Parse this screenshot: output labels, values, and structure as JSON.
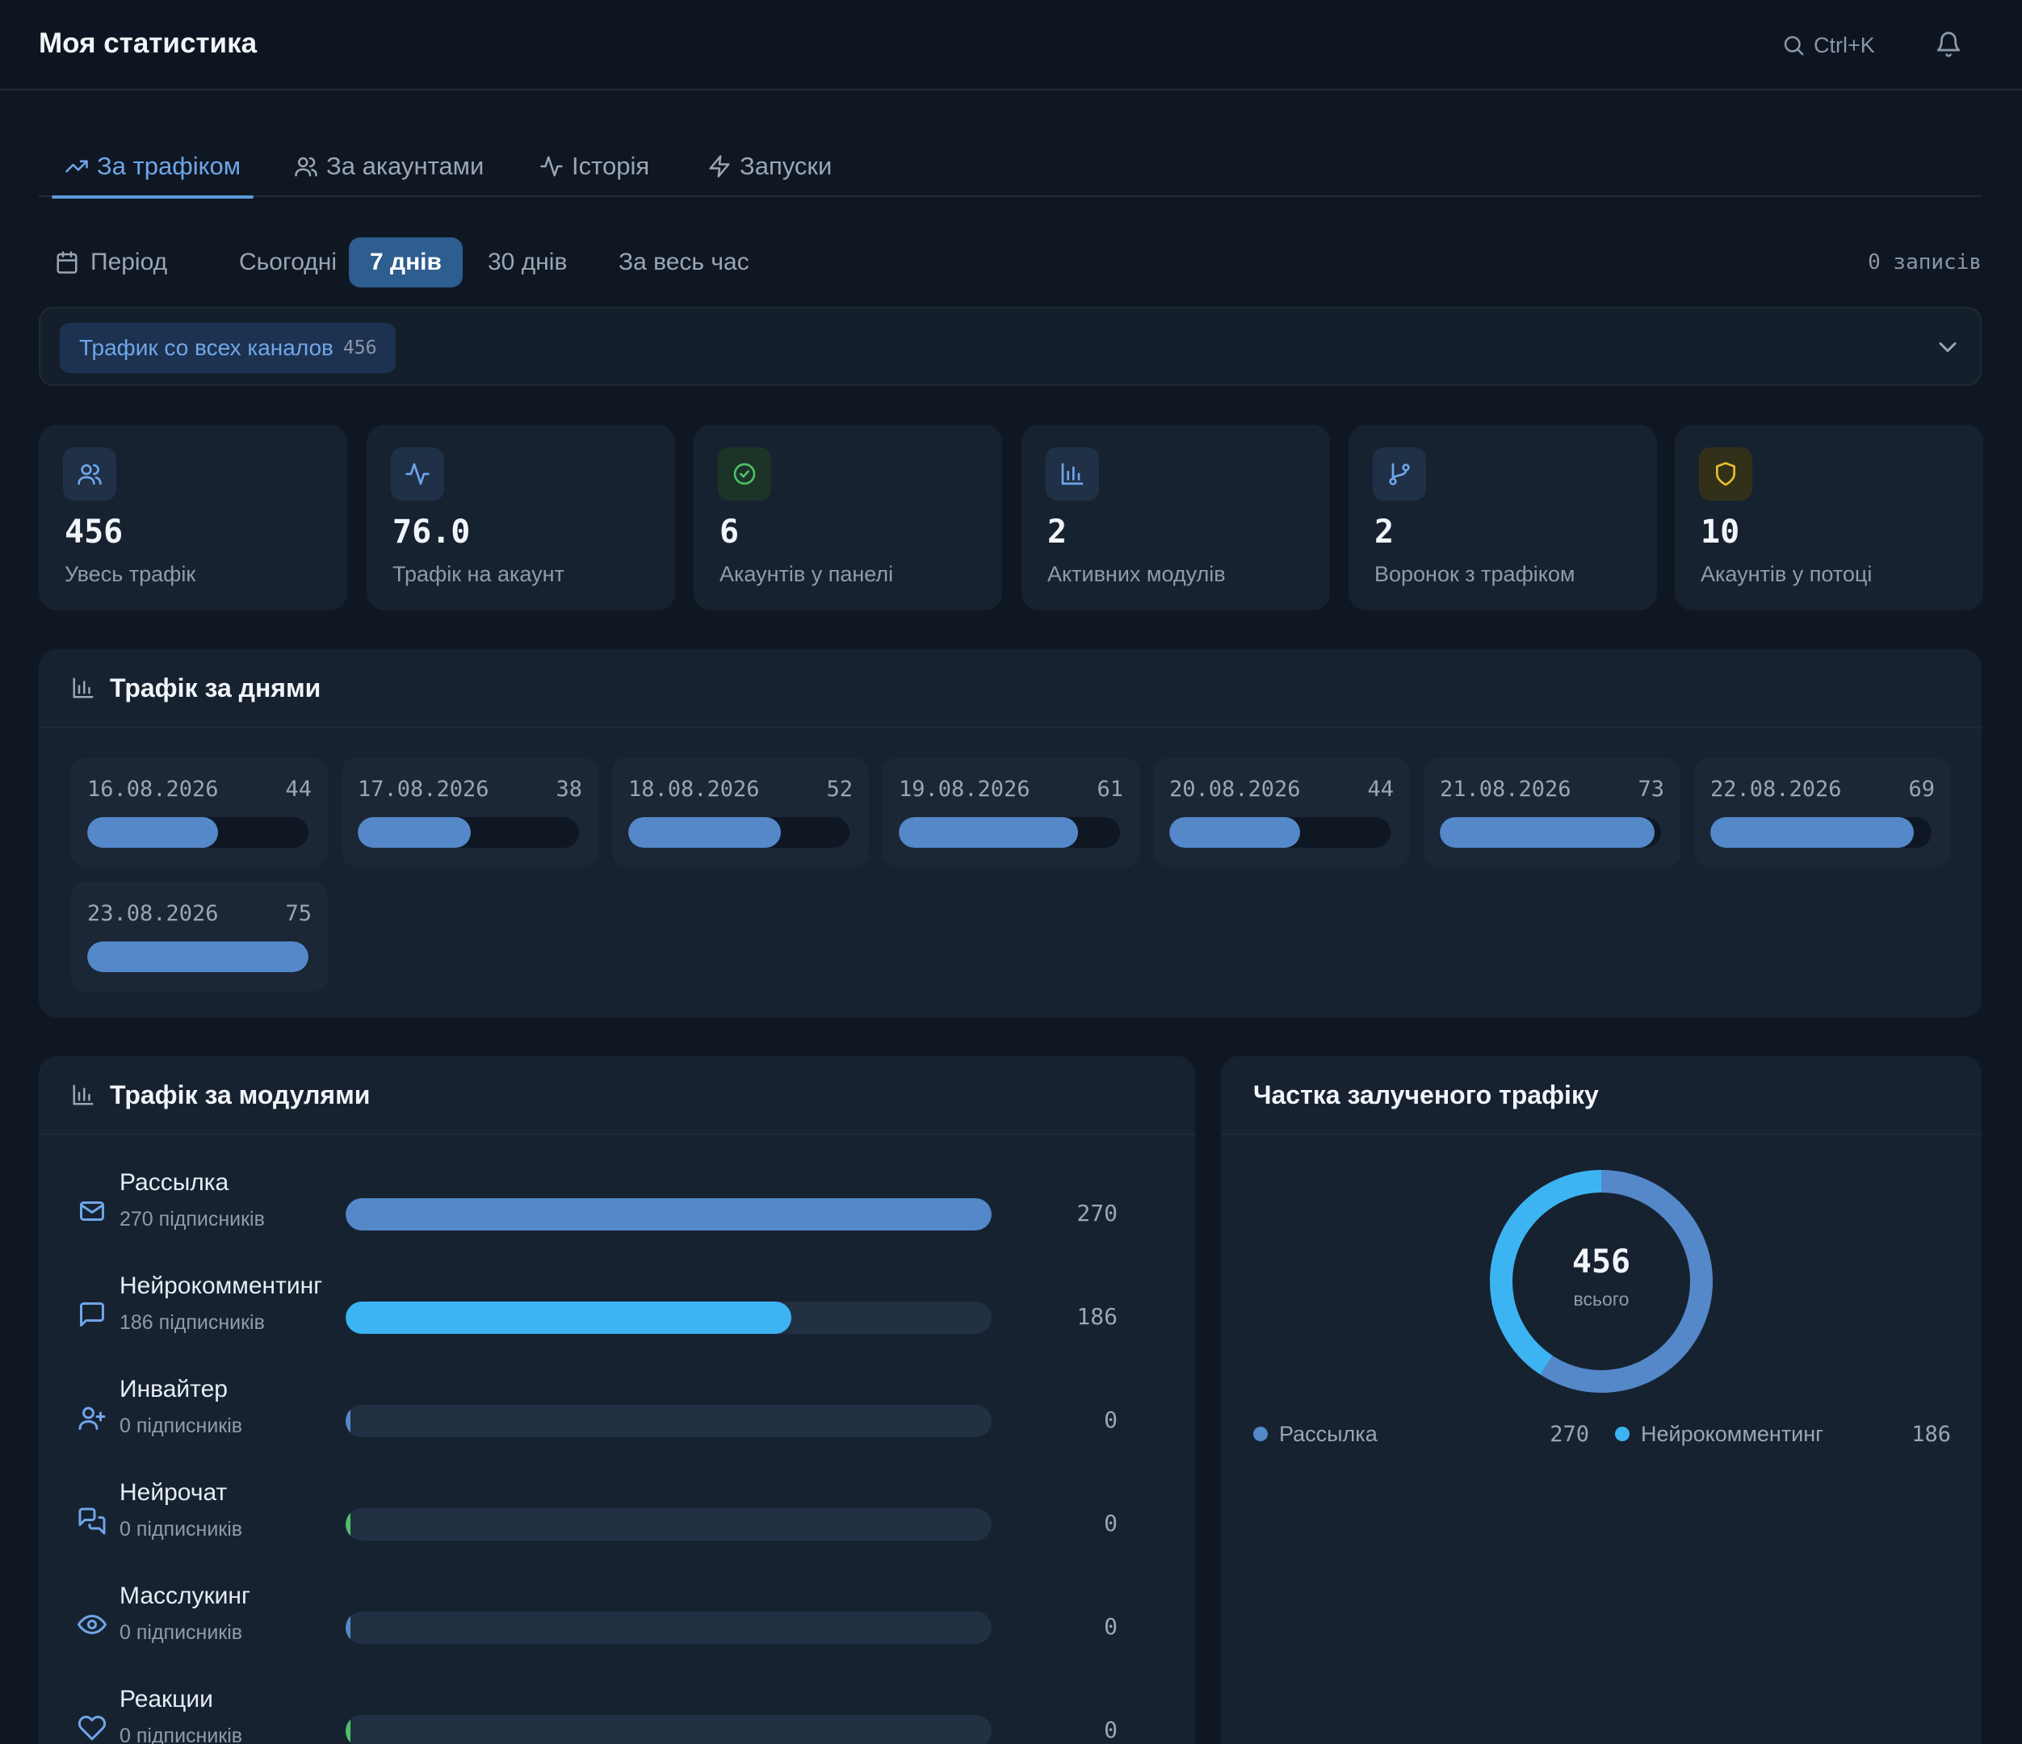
{
  "header": {
    "title": "Моя статистика",
    "search_shortcut": "Ctrl+K"
  },
  "tabs": [
    {
      "label": "За трафіком",
      "icon": "trending-up-icon",
      "active": true
    },
    {
      "label": "За акаунтами",
      "icon": "users-icon",
      "active": false
    },
    {
      "label": "Історія",
      "icon": "activity-icon",
      "active": false
    },
    {
      "label": "Запуски",
      "icon": "zap-icon",
      "active": false
    }
  ],
  "period": {
    "label": "Період",
    "options": [
      "Сьогодні",
      "7 днів",
      "30 днів",
      "За весь час"
    ],
    "selected": "7 днів",
    "records": "0 записів"
  },
  "channel": {
    "label": "Трафик со всех каналов",
    "count": "456"
  },
  "stats": [
    {
      "value": "456",
      "label": "Увесь трафік",
      "icon": "users-icon"
    },
    {
      "value": "76.0",
      "label": "Трафік на акаунт",
      "icon": "activity-icon"
    },
    {
      "value": "6",
      "label": "Акаунтів у панелі",
      "icon": "check-circle-icon"
    },
    {
      "value": "2",
      "label": "Активних модулів",
      "icon": "bar-chart-icon"
    },
    {
      "value": "2",
      "label": "Воронок з трафіком",
      "icon": "git-branch-icon"
    },
    {
      "value": "10",
      "label": "Акаунтів у потоці",
      "icon": "shield-icon"
    }
  ],
  "days_panel": {
    "title": "Трафік за днями",
    "days": [
      {
        "date": "16.08.2026",
        "value": 44,
        "fraction": 0.59
      },
      {
        "date": "17.08.2026",
        "value": 38,
        "fraction": 0.51
      },
      {
        "date": "18.08.2026",
        "value": 52,
        "fraction": 0.69
      },
      {
        "date": "19.08.2026",
        "value": 61,
        "fraction": 0.81
      },
      {
        "date": "20.08.2026",
        "value": 44,
        "fraction": 0.59
      },
      {
        "date": "21.08.2026",
        "value": 73,
        "fraction": 0.97
      },
      {
        "date": "22.08.2026",
        "value": 69,
        "fraction": 0.92
      },
      {
        "date": "23.08.2026",
        "value": 75,
        "fraction": 1.0
      }
    ]
  },
  "modules_panel": {
    "title": "Трафік за модулями",
    "modules": [
      {
        "name": "Рассылка",
        "sub": "270 підписників",
        "value": "270",
        "fraction": 1.0,
        "color": "#5488c9",
        "icon": "mail-icon"
      },
      {
        "name": "Нейрокомментинг",
        "sub": "186 підписників",
        "value": "186",
        "fraction": 0.69,
        "color": "#3db4f2",
        "icon": "message-square-icon"
      },
      {
        "name": "Инвайтер",
        "sub": "0 підписників",
        "value": "0",
        "fraction": 0,
        "color": "#5488c9",
        "icon": "user-plus-icon"
      },
      {
        "name": "Нейрочат",
        "sub": "0 підписників",
        "value": "0",
        "fraction": 0,
        "color": "#4fbf6a",
        "icon": "messages-icon"
      },
      {
        "name": "Масслукинг",
        "sub": "0 підписників",
        "value": "0",
        "fraction": 0,
        "color": "#5488c9",
        "icon": "eye-icon"
      },
      {
        "name": "Реакции",
        "sub": "0 підписників",
        "value": "0",
        "fraction": 0,
        "color": "#4fbf6a",
        "icon": "heart-icon"
      }
    ]
  },
  "share_panel": {
    "title": "Частка залученого трафіку",
    "total": "456",
    "total_label": "всього",
    "legend": [
      {
        "name": "Рассылка",
        "value": "270",
        "color": "#5488c9"
      },
      {
        "name": "Нейрокомментинг",
        "value": "186",
        "color": "#3db4f2"
      }
    ]
  },
  "colors": {
    "accent": "#5e9bdc",
    "background": "#0f1723",
    "panel": "#172231"
  }
}
